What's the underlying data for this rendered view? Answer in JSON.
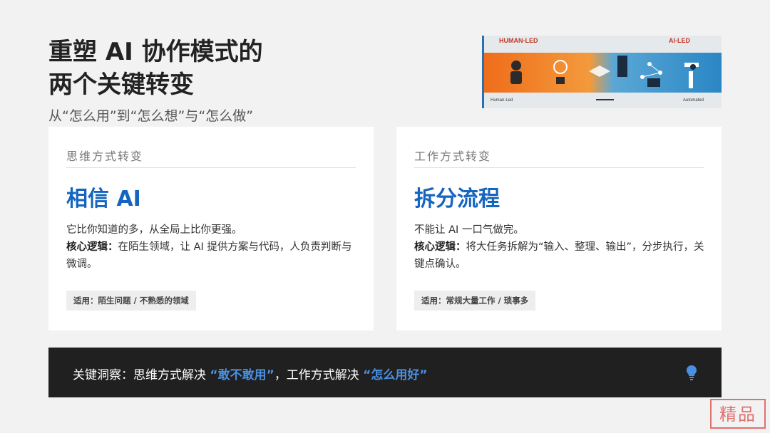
{
  "title": {
    "line1": "重塑 AI 协作模式的",
    "line2": "两个关键转变"
  },
  "subtitle": "从“怎么用”到“怎么想”与“怎么做”",
  "banner": {
    "left_top": "HUMAN-LED",
    "right_top": "AI-LED",
    "left_bottom": "Human-Led",
    "right_bottom": "Automated"
  },
  "cards": [
    {
      "kicker": "思维方式转变",
      "heading": "相信 AI",
      "line1": "它比你知道的多，从全局上比你更强。",
      "logic_label": "核心逻辑：",
      "logic_text": "在陌生领域，让 AI 提供方案与代码，人负责判断与微调。",
      "tag": "适用：陌生问题 / 不熟悉的领域"
    },
    {
      "kicker": "工作方式转变",
      "heading": "拆分流程",
      "line1": "不能让 AI 一口气做完。",
      "logic_label": "核心逻辑：",
      "logic_text": "将大任务拆解为“输入、整理、输出”，分步执行，关键点确认。",
      "tag": "适用：常规大量工作 / 琐事多"
    }
  ],
  "insight": {
    "prefix": "关键洞察：思维方式解决 ",
    "hl1": "“敢不敢用”",
    "middle": "，工作方式解决 ",
    "hl2": "“怎么用好”"
  },
  "stamp": "精品"
}
